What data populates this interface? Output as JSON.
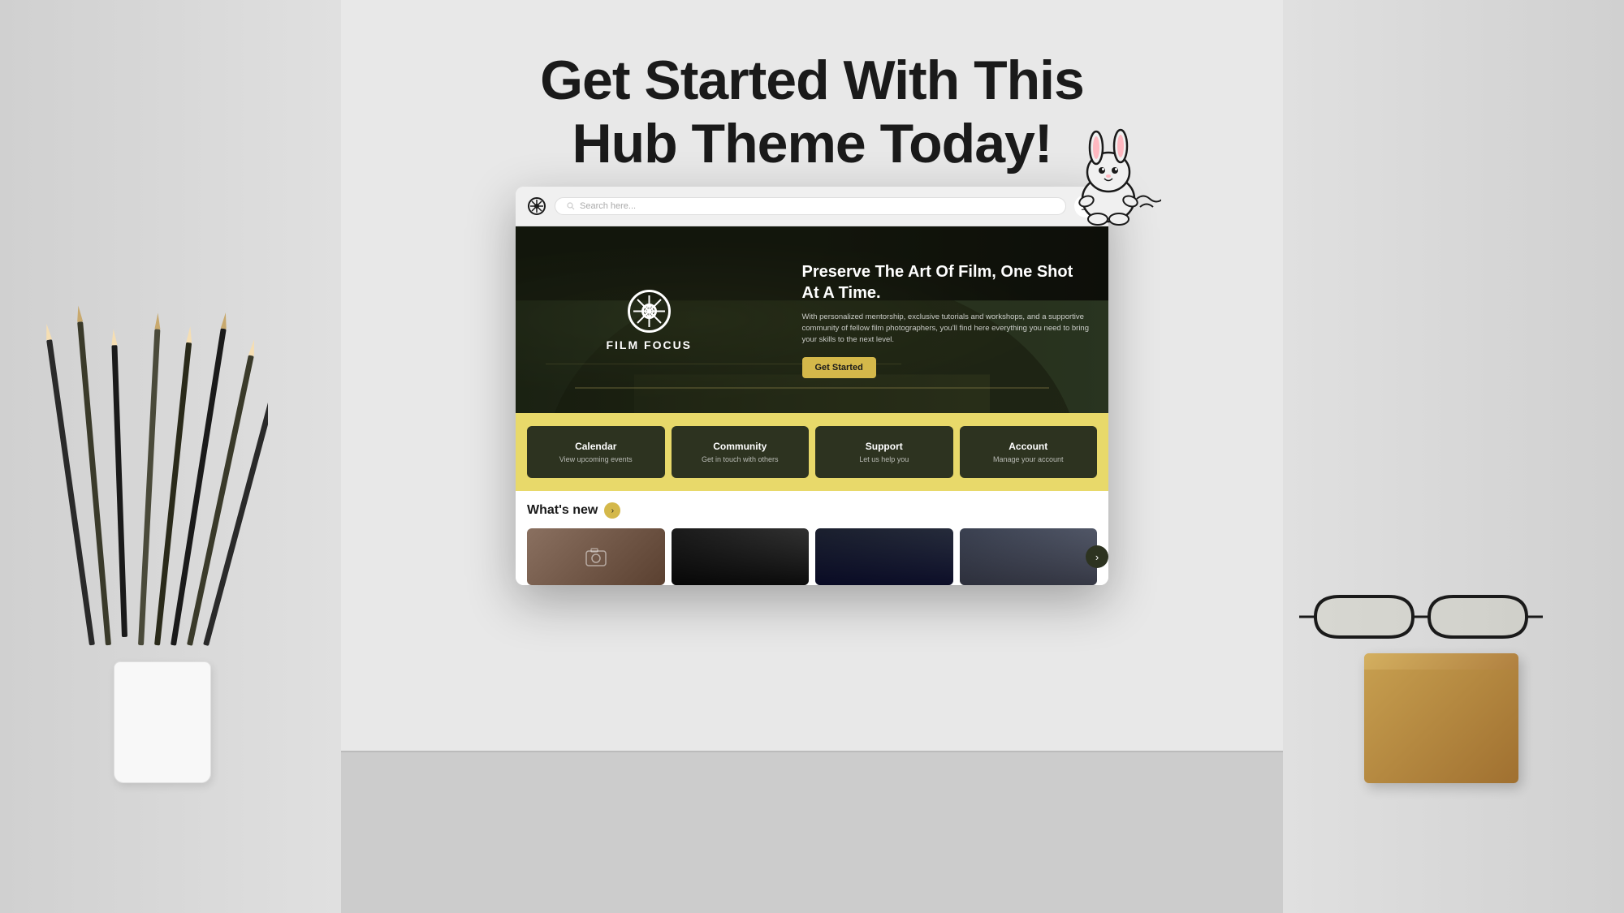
{
  "page": {
    "bg_color": "#e0e0e0",
    "heading_line1": "Get Started With This",
    "heading_line2": "Hub Theme Today!"
  },
  "browser": {
    "search_placeholder": "Search here...",
    "menu_icon": "☰"
  },
  "hero": {
    "logo_text": "FILM FOCUS",
    "title": "Preserve The Art Of Film, One Shot At A Time.",
    "description": "With personalized mentorship, exclusive tutorials and workshops, and a supportive community of fellow film photographers, you'll find here everything you need to bring your skills to the next level.",
    "cta_label": "Get Started"
  },
  "nav_cards": [
    {
      "title": "Calendar",
      "subtitle": "View upcoming events"
    },
    {
      "title": "Community",
      "subtitle": "Get in touch with others"
    },
    {
      "title": "Support",
      "subtitle": "Let us help you"
    },
    {
      "title": "Account",
      "subtitle": "Manage your account"
    }
  ],
  "whats_new": {
    "title": "What's new",
    "arrow_icon": "›",
    "next_icon": "›",
    "cards": [
      {
        "id": 1
      },
      {
        "id": 2
      },
      {
        "id": 3
      },
      {
        "id": 4
      }
    ]
  }
}
